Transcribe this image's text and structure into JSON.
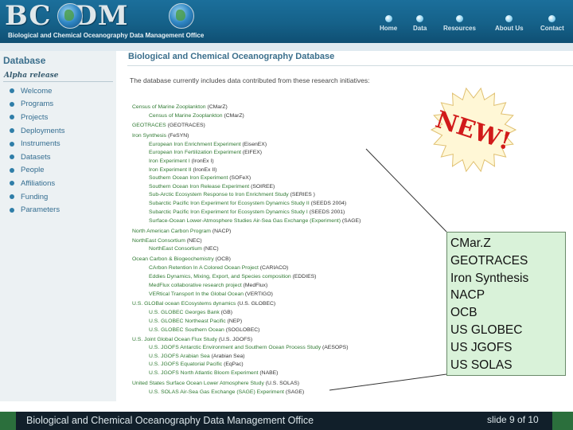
{
  "header": {
    "logo_text": "BC  -DM ",
    "tagline": "Biological and Chemical Oceanography Data Management Office",
    "nav": [
      "Home",
      "Data",
      "Resources",
      "About Us",
      "Contact"
    ]
  },
  "sidebar": {
    "title": "Database",
    "subtitle": "Alpha release",
    "items": [
      "Welcome",
      "Programs",
      "Projects",
      "Deployments",
      "Instruments",
      "Datasets",
      "People",
      "Affiliations",
      "Funding",
      "Parameters"
    ]
  },
  "content": {
    "title": "Biological and Chemical Oceanography Database",
    "intro": "The database currently includes data contributed from these research initiatives:",
    "projects": [
      {
        "name": "Census of Marine Zooplankton",
        "abbr": "(CMarZ)",
        "level": 0
      },
      {
        "name": "Census of Marine Zooplankton",
        "abbr": "(CMarZ)",
        "level": 1
      },
      {
        "name": "GEOTRACES",
        "abbr": "(GEOTRACES)",
        "level": 0
      },
      {
        "name": "Iron Synthesis",
        "abbr": "(FeSYN)",
        "level": 0
      },
      {
        "name": "European Iron Enrichment Experiment",
        "abbr": "(EisenEX)",
        "level": 1
      },
      {
        "name": "European Iron Fertilization Experiment",
        "abbr": "(EIFEX)",
        "level": 1
      },
      {
        "name": "Iron Experiment I",
        "abbr": "(IronEx I)",
        "level": 1
      },
      {
        "name": "Iron Experiment II",
        "abbr": "(IronEx II)",
        "level": 1
      },
      {
        "name": "Southern Ocean Iron Experiment",
        "abbr": "(SOFeX)",
        "level": 1
      },
      {
        "name": "Southern Ocean Iron Release Experiment",
        "abbr": "(SOIREE)",
        "level": 1
      },
      {
        "name": "Sub-Arctic Ecosystem Response to Iron Enrichment Study",
        "abbr": "(SERIES )",
        "level": 1
      },
      {
        "name": "Subarctic Pacific Iron Experiment for Ecosystem Dynamics Study II",
        "abbr": "(SEEDS 2004)",
        "level": 1
      },
      {
        "name": "Subarctic Pacific Iron Experiment for Ecosystem Dynamics Study I",
        "abbr": "(SEEDS 2001)",
        "level": 1
      },
      {
        "name": "Surface-Ocean Lower-Atmosphere Studies Air-Sea Gas Exchange (Experiment)",
        "abbr": "(SAGE)",
        "level": 1
      },
      {
        "name": "North American Carbon Program",
        "abbr": "(NACP)",
        "level": 0
      },
      {
        "name": "NorthEast Consortium",
        "abbr": "(NEC)",
        "level": 0
      },
      {
        "name": "NorthEast Consortium",
        "abbr": "(NEC)",
        "level": 1
      },
      {
        "name": "Ocean Carbon & Biogeochemistry",
        "abbr": "(OCB)",
        "level": 0
      },
      {
        "name": "CArbon Retention In A Colored Ocean Project",
        "abbr": "(CARIACO)",
        "level": 1
      },
      {
        "name": "Eddies Dynamics, Mixing, Export, and Species composition",
        "abbr": "(EDDIES)",
        "level": 1
      },
      {
        "name": "MedFlux collaborative research project",
        "abbr": "(MedFlux)",
        "level": 1
      },
      {
        "name": "VERtical Transport In the Global Ocean",
        "abbr": "(VERTIGO)",
        "level": 1
      },
      {
        "name": "U.S. GLOBal ocean ECosystems dynamics",
        "abbr": "(U.S. GLOBEC)",
        "level": 0
      },
      {
        "name": "U.S. GLOBEC Georges Bank",
        "abbr": "(GB)",
        "level": 1
      },
      {
        "name": "U.S. GLOBEC Northeast Pacific",
        "abbr": "(NEP)",
        "level": 1
      },
      {
        "name": "U.S. GLOBEC Southern Ocean",
        "abbr": "(SOGLOBEC)",
        "level": 1
      },
      {
        "name": "U.S. Joint Global Ocean Flux Study",
        "abbr": "(U.S. JGOFS)",
        "level": 0
      },
      {
        "name": "U.S. JGOFS Antarctic Environment and Southern Ocean Process Study",
        "abbr": "(AESOPS)",
        "level": 1
      },
      {
        "name": "U.S. JGOFS Arabian Sea",
        "abbr": "(Arabian Sea)",
        "level": 1
      },
      {
        "name": "U.S. JGOFS Equatorial Pacific",
        "abbr": "(EqPac)",
        "level": 1
      },
      {
        "name": "U.S. JGOFS North Atlantic Bloom Experiment",
        "abbr": "(NABE)",
        "level": 1
      },
      {
        "name": "United States Surface Ocean Lower Atmosphere Study",
        "abbr": "(U.S. SOLAS)",
        "level": 0
      },
      {
        "name": "U.S. SOLAS Air-Sea Gas Exchange (SAGE) Experiment",
        "abbr": "(SAGE)",
        "level": 1
      }
    ]
  },
  "new_badge": "NEW!",
  "callout": [
    "CMar.Z",
    "GEOTRACES",
    "Iron Synthesis",
    "NACP",
    "OCB",
    "US GLOBEC",
    "US JGOFS",
    "US SOLAS"
  ],
  "footer": {
    "left": "Biological and Chemical Oceanography Data Management Office",
    "right": "slide 9 of 10"
  },
  "colors": {
    "header": "#156189",
    "link_green": "#2f7a32",
    "sidebar_link": "#356e91",
    "new_red": "#d11a1a",
    "callout_bg": "#d9f2d9",
    "footer": "#111f2a"
  }
}
